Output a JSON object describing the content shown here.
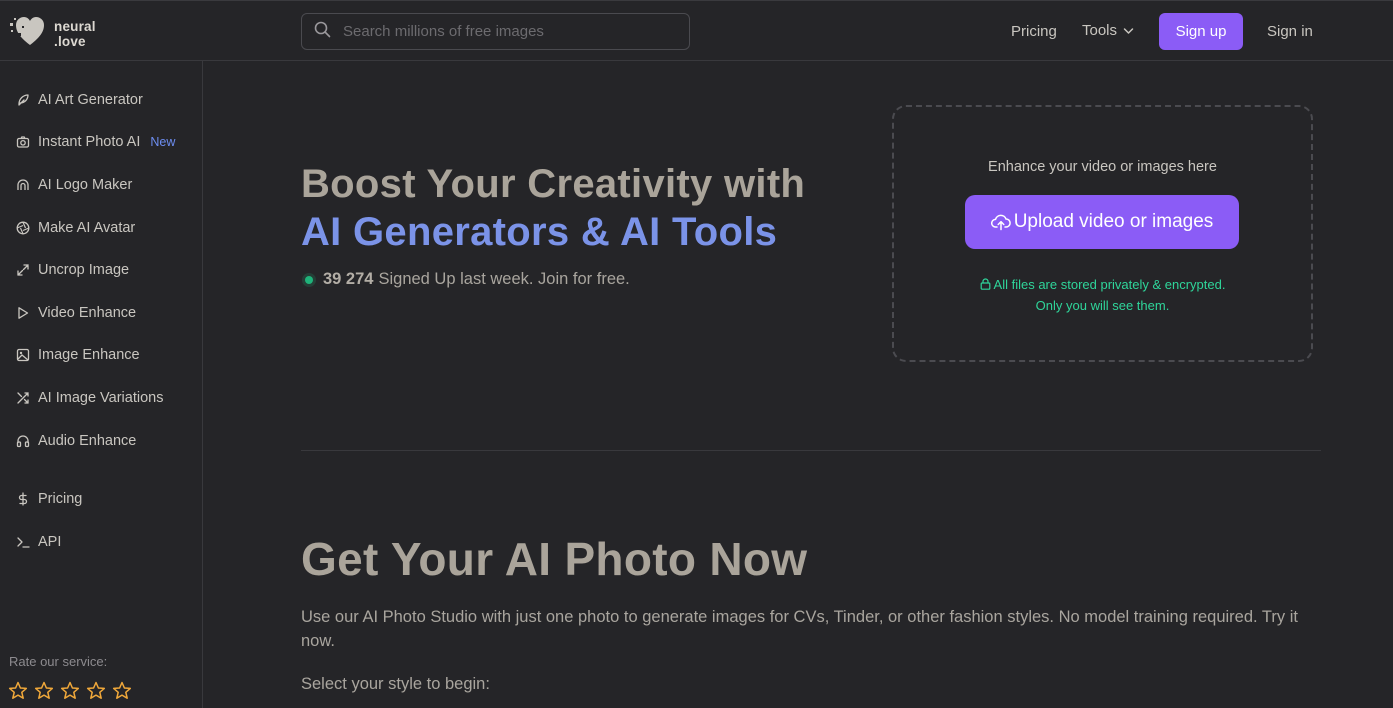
{
  "header": {
    "logo_line1": "neural",
    "logo_line2": ".love",
    "search_placeholder": "Search millions of free images",
    "nav_pricing": "Pricing",
    "nav_tools": "Tools",
    "signup_label": "Sign up",
    "signin_label": "Sign in"
  },
  "sidebar": {
    "items": [
      {
        "label": "AI Art Generator",
        "icon": "feather-icon"
      },
      {
        "label": "Instant Photo AI",
        "icon": "camera-icon",
        "badge": "New"
      },
      {
        "label": "AI Logo Maker",
        "icon": "arch-icon"
      },
      {
        "label": "Make AI Avatar",
        "icon": "aperture-icon"
      },
      {
        "label": "Uncrop Image",
        "icon": "expand-icon"
      },
      {
        "label": "Video Enhance",
        "icon": "play-icon"
      },
      {
        "label": "Image Enhance",
        "icon": "image-icon"
      },
      {
        "label": "AI Image Variations",
        "icon": "shuffle-icon"
      },
      {
        "label": "Audio Enhance",
        "icon": "headphones-icon"
      },
      {
        "label": "Pricing",
        "icon": "dollar-icon"
      },
      {
        "label": "API",
        "icon": "terminal-icon"
      }
    ],
    "rate_label": "Rate our service:",
    "stars": 5
  },
  "hero": {
    "title_line1": "Boost Your Creativity with",
    "title_line2": "AI Generators & AI Tools",
    "signed_count": "39 274",
    "signed_text": "Signed Up last week. Join for free."
  },
  "upload": {
    "label": "Enhance your video or images here",
    "button": "Upload video or images",
    "privacy_line1": "All files are stored privately & encrypted.",
    "privacy_line2": "Only you will see them."
  },
  "photo": {
    "title": "Get Your AI Photo Now",
    "description": "Use our AI Photo Studio with just one photo to generate images for CVs, Tinder, or other fashion styles. No model training required. Try it now.",
    "style_prompt": "Select your style to begin:"
  },
  "colors": {
    "accent": "#8b5cf6",
    "title_accent": "#7b93e8",
    "success": "#2fd59a",
    "background": "#252528"
  }
}
